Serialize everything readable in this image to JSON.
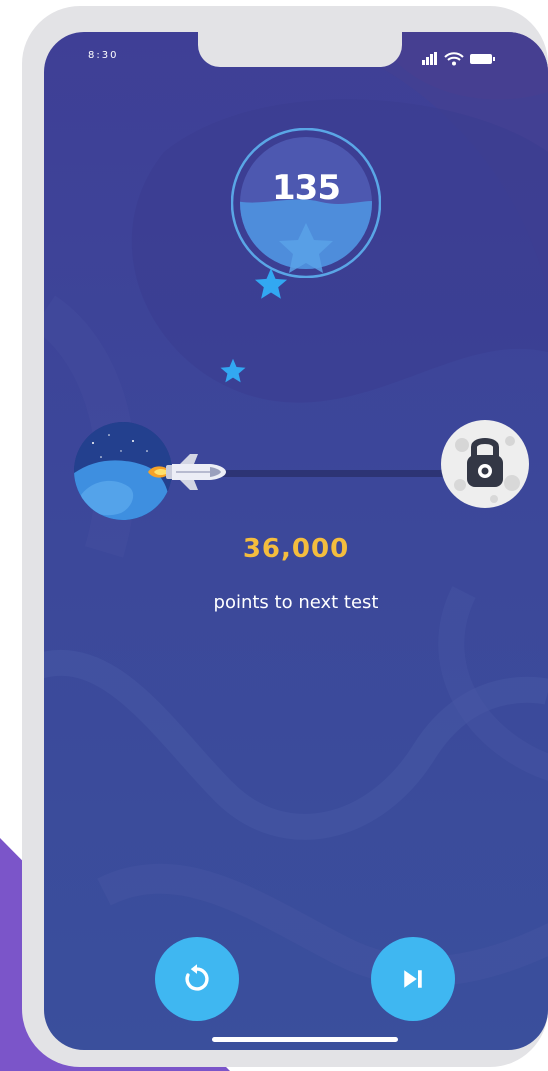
{
  "status_bar": {
    "time": "8:30",
    "icons": [
      "signal-icon",
      "wifi-icon",
      "battery-icon"
    ]
  },
  "score_badge": {
    "value": "135",
    "fill_fraction": 0.5,
    "icon": "star-icon"
  },
  "progress": {
    "start_icon": "earth-planet-icon",
    "ship_icon": "rocket-icon",
    "end_icon": "locked-moon-icon",
    "points_value": "36,000",
    "points_label": "points to next test"
  },
  "controls": {
    "restart_icon": "restart-icon",
    "next_icon": "skip-next-icon"
  },
  "colors": {
    "background_top": "#3f3f96",
    "background_bottom": "#3a4f9c",
    "accent_blue": "#3fb7f1",
    "points_gold": "#f4bd3e",
    "star_blue": "#32a8f2",
    "device_frame": "#e3e3e6",
    "corner_purple": "#7b55c9"
  }
}
